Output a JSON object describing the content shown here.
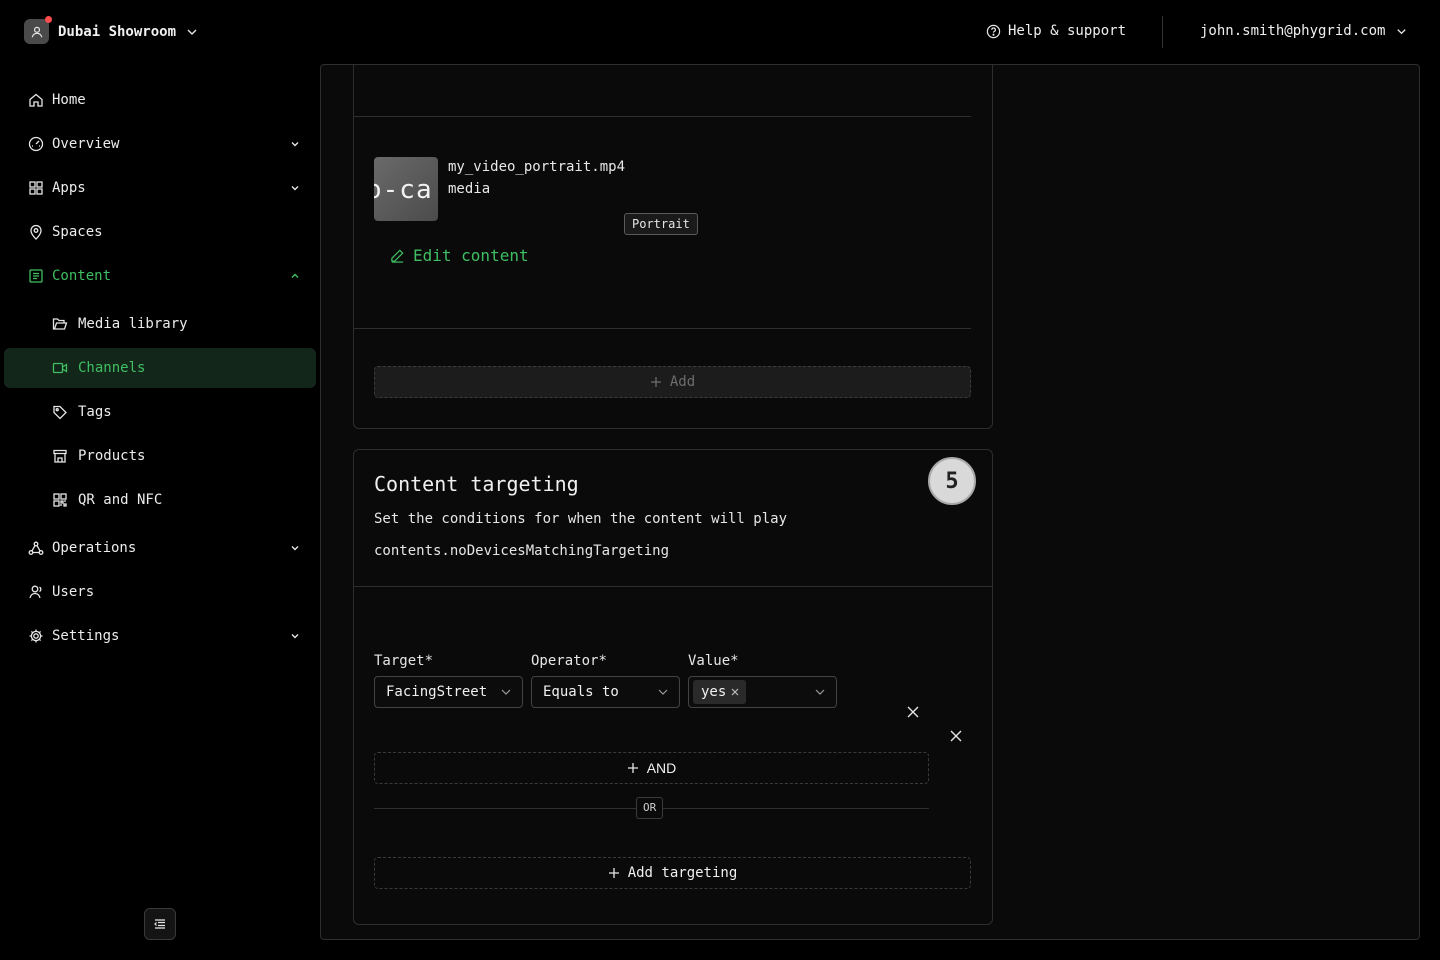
{
  "header": {
    "org_name": "Dubai Showroom",
    "help_label": "Help & support",
    "user_email": "john.smith@phygrid.com"
  },
  "sidebar": {
    "items": [
      {
        "label": "Home",
        "icon": "home-icon"
      },
      {
        "label": "Overview",
        "icon": "gauge-icon"
      },
      {
        "label": "Apps",
        "icon": "grid-icon"
      },
      {
        "label": "Spaces",
        "icon": "map-pin-icon"
      },
      {
        "label": "Content",
        "icon": "content-icon"
      },
      {
        "label": "Media library",
        "icon": "folder-icon"
      },
      {
        "label": "Channels",
        "icon": "video-icon"
      },
      {
        "label": "Tags",
        "icon": "tag-icon"
      },
      {
        "label": "Products",
        "icon": "store-icon"
      },
      {
        "label": "QR and NFC",
        "icon": "qr-icon"
      },
      {
        "label": "Operations",
        "icon": "network-icon"
      },
      {
        "label": "Users",
        "icon": "users-icon"
      },
      {
        "label": "Settings",
        "icon": "gear-icon"
      }
    ],
    "active_item": "Channels"
  },
  "media": {
    "thumbnail_text": "o-ca",
    "file_name": "my_video_portrait.mp4",
    "type": "media",
    "orientation_badge": "Portrait",
    "edit_label": "Edit content",
    "add_label": "Add"
  },
  "targeting": {
    "step_number": "5",
    "title": "Content targeting",
    "description": "Set the conditions for when the content will play",
    "message_key": "contents.noDevicesMatchingTargeting",
    "labels": {
      "target": "Target",
      "operator": "Operator",
      "value": "Value",
      "required_mark": "*"
    },
    "rule": {
      "target": "FacingStreet",
      "operator": "Equals to",
      "value_tag": "yes"
    },
    "and_label": "AND",
    "or_label": "OR",
    "add_targeting_label": "Add targeting"
  },
  "colors": {
    "accent": "#3fbf62",
    "active_bg": "#13261a",
    "background": "#000000"
  }
}
